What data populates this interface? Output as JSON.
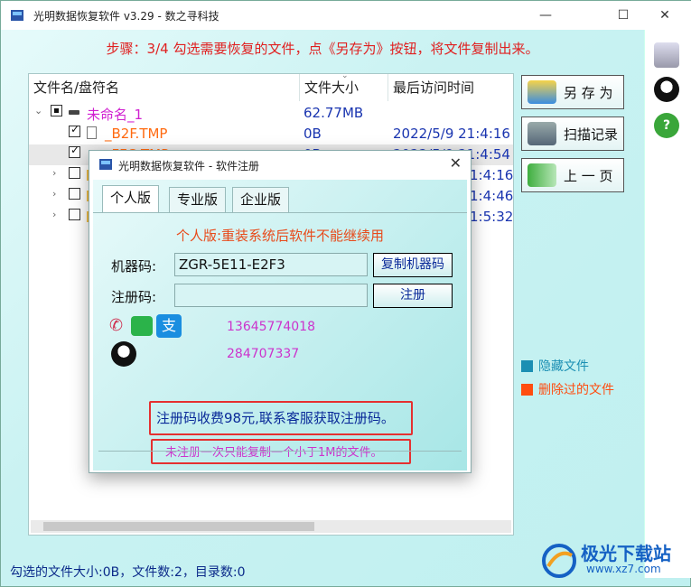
{
  "window": {
    "title": "光明数据恢复软件 v3.29 - 数之寻科技",
    "minimize": "—",
    "maximize": "☐",
    "close": "✕"
  },
  "hint": "步骤：3/4 勾选需要恢复的文件，点《另存为》按钮，将文件复制出来。",
  "columns": {
    "name": "文件名/盘符名",
    "size": "文件大小",
    "time": "最后访问时间"
  },
  "rows": [
    {
      "name": "未命名_1",
      "size": "62.77MB",
      "time": ""
    },
    {
      "name": "_B2F.TMP",
      "size": "0B",
      "time": "2022/5/9 21:4:16"
    },
    {
      "name": "_FFC.TMP",
      "size": "0B",
      "time": "2022/5/9 21:4:54"
    },
    {
      "time": "1:4:16"
    },
    {
      "time": "1:4:46"
    },
    {
      "time": "1:5:32"
    }
  ],
  "buttons": {
    "save_as": "另 存 为",
    "scan_log": "扫描记录",
    "prev_page": "上 一 页"
  },
  "legend": {
    "hidden": "隐藏文件",
    "deleted": "删除过的文件"
  },
  "status": "勾选的文件大小:0B，文件数:2，目录数:0",
  "watermark": {
    "title": "极光下载站",
    "url": "www.xz7.com"
  },
  "dialog": {
    "title": "光明数据恢复软件 - 软件注册",
    "close": "✕",
    "tabs": [
      "个人版",
      "专业版",
      "企业版"
    ],
    "tier_note": "个人版:重装系统后软件不能继续用",
    "machine_code_label": "机器码:",
    "machine_code": "ZGR-5E11-E2F3",
    "copy_button": "复制机器码",
    "reg_code_label": "注册码:",
    "reg_code": "",
    "register_button": "注册",
    "phone": "13645774018",
    "qq": "284707337",
    "fee_text": "注册码收费98元,联系客服获取注册码。",
    "limit_text": "未注册一次只能复制一个小于1M的文件。"
  },
  "colors": {
    "hint": "#e02020",
    "hidden": "#1b8fb3",
    "deleted": "#ff4d10",
    "highlight_box": "#e53030"
  }
}
